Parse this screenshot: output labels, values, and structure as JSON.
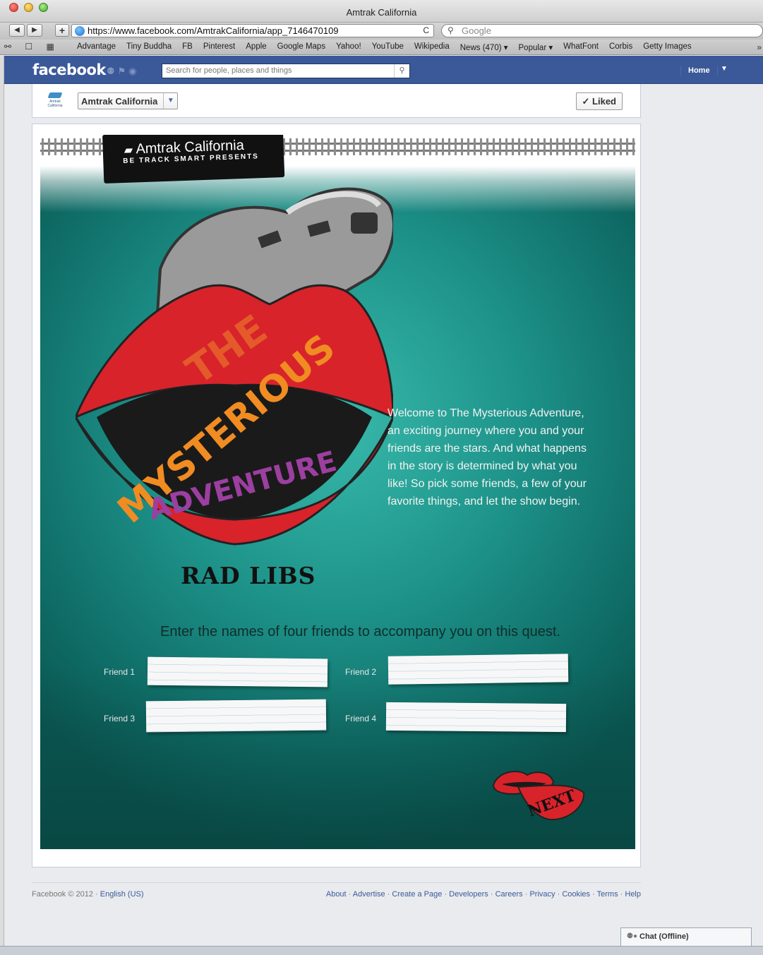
{
  "window": {
    "title": "Amtrak California"
  },
  "browser": {
    "back_label": "◀",
    "forward_label": "▶",
    "add_label": "+",
    "url": "https://www.facebook.com/AmtrakCalifornia/app_7146470109",
    "reload_label": "C",
    "search_placeholder": "Google",
    "bookmarks": [
      "Advantage",
      "Tiny Buddha",
      "FB",
      "Pinterest",
      "Apple",
      "Google Maps",
      "Yahoo!",
      "YouTube",
      "Wikipedia",
      "News (470) ▾",
      "Popular ▾",
      "WhatFont",
      "Corbis",
      "Getty Images"
    ]
  },
  "facebook": {
    "logo": "facebook",
    "search_placeholder": "Search for people, places and things",
    "home_label": "Home"
  },
  "page": {
    "logo_text": "Amtrak California",
    "name": "Amtrak California",
    "liked_label": "✓ Liked"
  },
  "app": {
    "brand_name": "Amtrak California",
    "brand_tagline": "BE TRACK SMART PRESENTS",
    "title_line1": "THE",
    "title_line2": "MYSTERIOUS",
    "title_line3": "ADVENTURE",
    "subtitle": "RAD LIBS",
    "intro": "Welcome to The Mysterious Adventure, an exciting journey where you and your friends are the stars. And what happens in the story is determined by what you like! So pick some friends, a few of your favorite things, and let the show begin.",
    "prompt": "Enter the names of four friends to accompany you on this quest.",
    "friends": [
      {
        "label": "Friend 1",
        "value": ""
      },
      {
        "label": "Friend 2",
        "value": ""
      },
      {
        "label": "Friend 3",
        "value": ""
      },
      {
        "label": "Friend 4",
        "value": ""
      }
    ],
    "next_label": "NEXT",
    "colors": {
      "lips": "#d8232b",
      "teal": "#1d9289",
      "train": "#a8a8a8",
      "orange": "#f08c22",
      "purple": "#9c3fa0"
    }
  },
  "footer": {
    "copyright": "Facebook © 2012 ·",
    "language": "English (US)",
    "links": [
      "About",
      "Advertise",
      "Create a Page",
      "Developers",
      "Careers",
      "Privacy",
      "Cookies",
      "Terms",
      "Help"
    ]
  },
  "chat": {
    "label": "Chat (Offline)"
  }
}
